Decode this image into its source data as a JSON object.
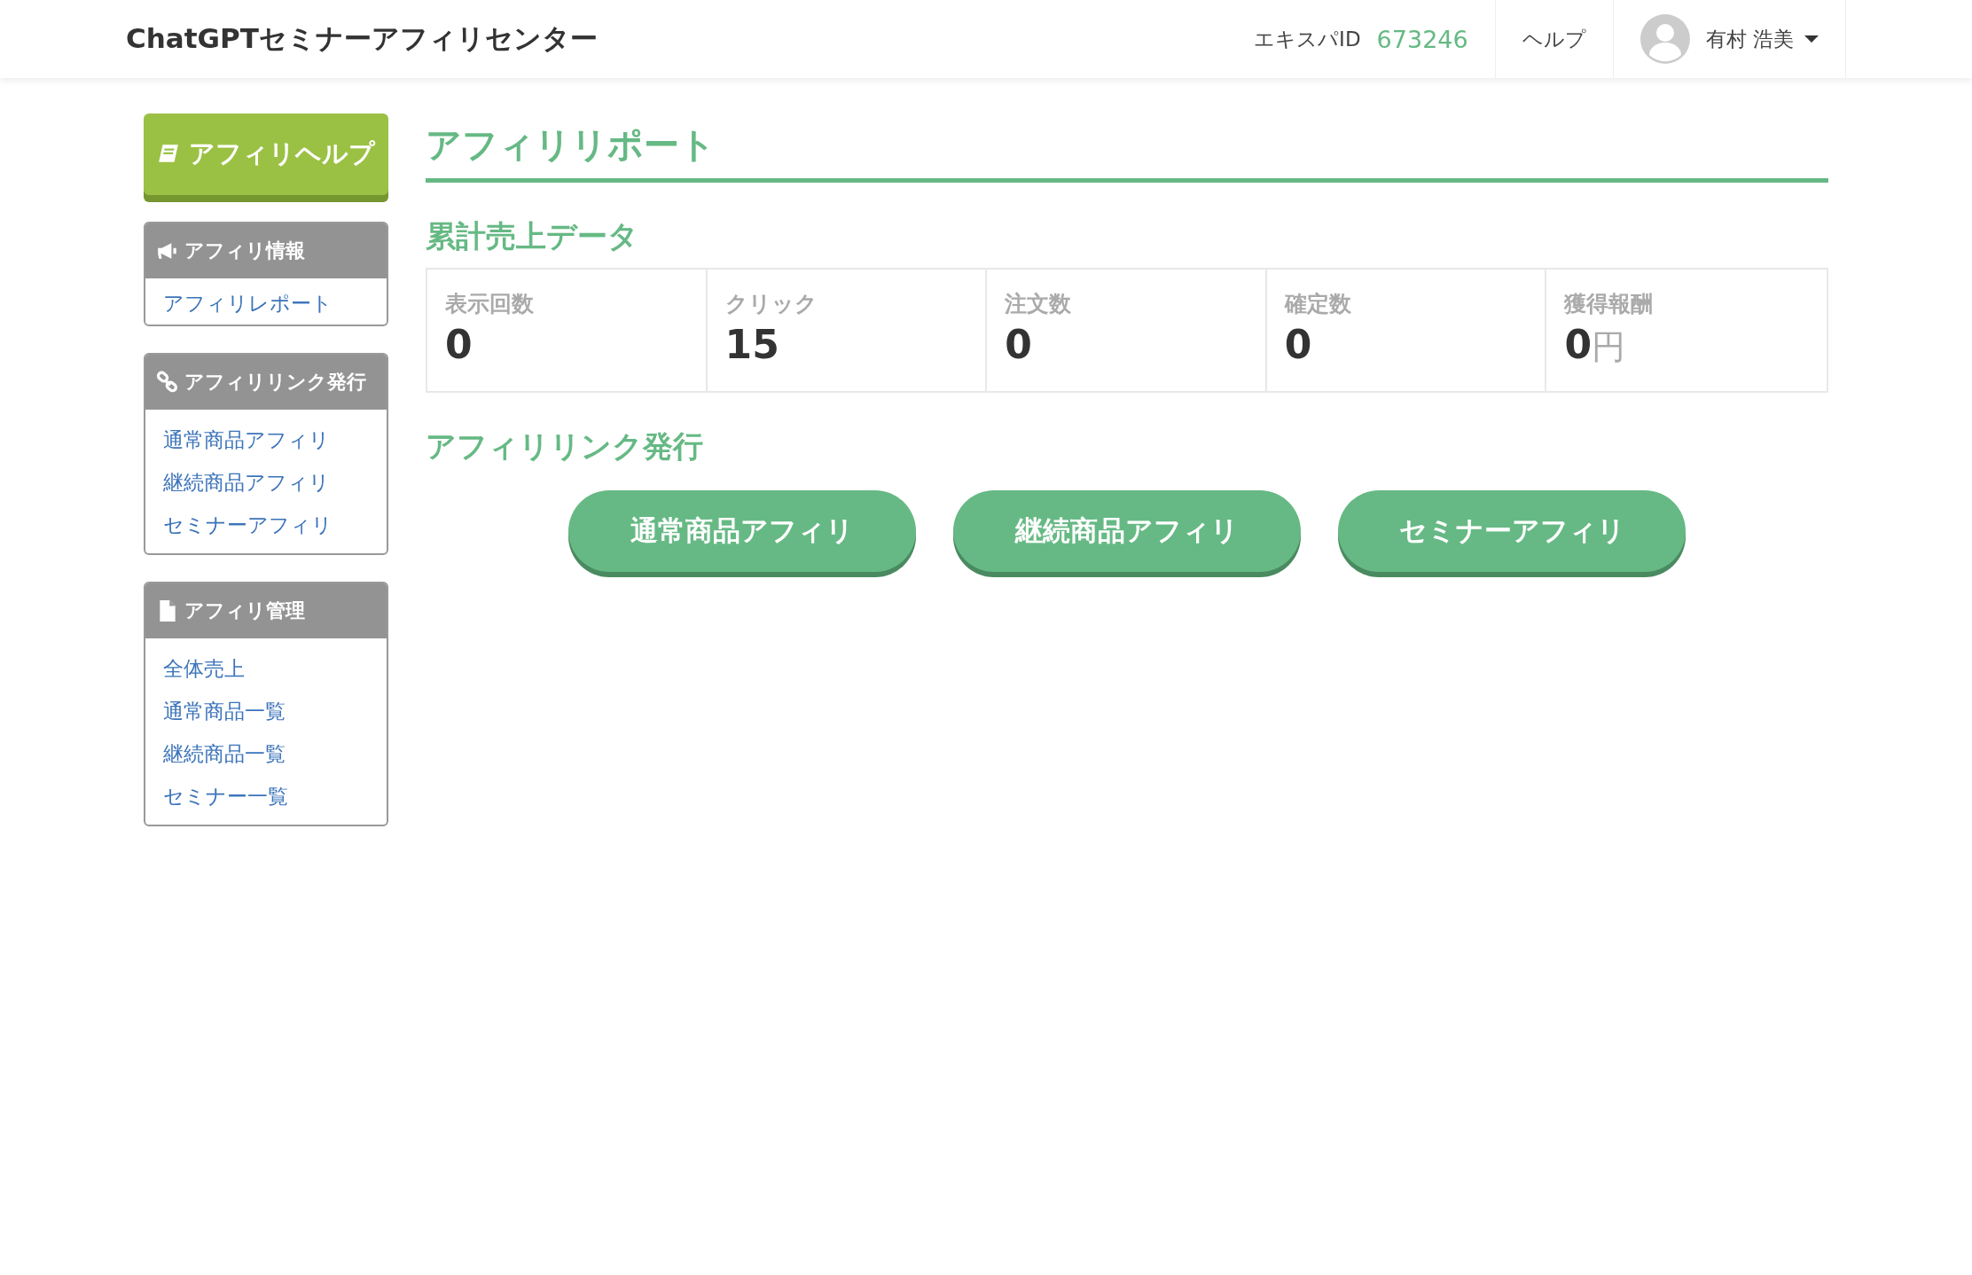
{
  "header": {
    "brand": "ChatGPTセミナーアフィリセンター",
    "expert_id_label": "エキスパID",
    "expert_id": "673246",
    "help": "ヘルプ",
    "user_name": "有村 浩美"
  },
  "sidebar": {
    "help_button": "アフィリヘルプ",
    "panels": [
      {
        "title": "アフィリ情報",
        "items": [
          "アフィリレポート"
        ]
      },
      {
        "title": "アフィリリンク発行",
        "items": [
          "通常商品アフィリ",
          "継続商品アフィリ",
          "セミナーアフィリ"
        ]
      },
      {
        "title": "アフィリ管理",
        "items": [
          "全体売上",
          "通常商品一覧",
          "継続商品一覧",
          "セミナー一覧"
        ]
      }
    ]
  },
  "main": {
    "title": "アフィリリポート",
    "stats_title": "累計売上データ",
    "stats": [
      {
        "label": "表示回数",
        "value": "0"
      },
      {
        "label": "クリック",
        "value": "15"
      },
      {
        "label": "注文数",
        "value": "0"
      },
      {
        "label": "確定数",
        "value": "0"
      },
      {
        "label": "獲得報酬",
        "value": "0",
        "unit": "円"
      }
    ],
    "links_title": "アフィリリンク発行",
    "link_buttons": [
      "通常商品アフィリ",
      "継続商品アフィリ",
      "セミナーアフィリ"
    ]
  }
}
